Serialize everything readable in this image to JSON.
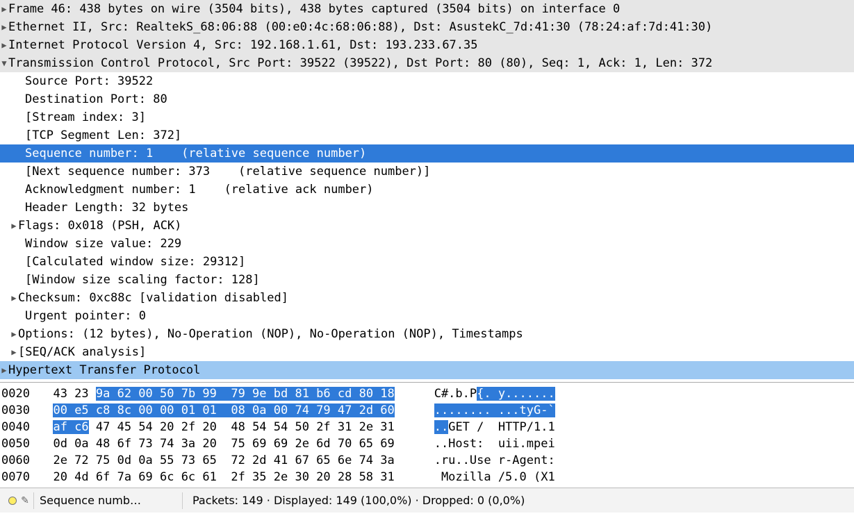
{
  "tree": {
    "frame": "Frame 46: 438 bytes on wire (3504 bits), 438 bytes captured (3504 bits) on interface 0",
    "eth": "Ethernet II, Src: RealtekS_68:06:88 (00:e0:4c:68:06:88), Dst: AsustekC_7d:41:30 (78:24:af:7d:41:30)",
    "ip": "Internet Protocol Version 4, Src: 192.168.1.61, Dst: 193.233.67.35",
    "tcp": "Transmission Control Protocol, Src Port: 39522 (39522), Dst Port: 80 (80), Seq: 1, Ack: 1, Len: 372",
    "srcport": "Source Port: 39522",
    "dstport": "Destination Port: 80",
    "stream": "[Stream index: 3]",
    "seglen": "[TCP Segment Len: 372]",
    "seqnum": "Sequence number: 1    (relative sequence number)",
    "nextseq": "[Next sequence number: 373    (relative sequence number)]",
    "acknum": "Acknowledgment number: 1    (relative ack number)",
    "hdrlen": "Header Length: 32 bytes",
    "flags": "Flags: 0x018 (PSH, ACK)",
    "winsize": "Window size value: 229",
    "calcwin": "[Calculated window size: 29312]",
    "winscale": "[Window size scaling factor: 128]",
    "checksum": "Checksum: 0xc88c [validation disabled]",
    "urgent": "Urgent pointer: 0",
    "options": "Options: (12 bytes), No-Operation (NOP), No-Operation (NOP), Timestamps",
    "seqack": "[SEQ/ACK analysis]",
    "http": "Hypertext Transfer Protocol"
  },
  "hex": {
    "rows": [
      {
        "off": "0020",
        "pre": "  43 23 ",
        "hl": "9a 62 00 50 7b 99  79 9e bd 81 b6 cd 80 18",
        "post": "",
        "asc_pre": "   C#.b.P",
        "asc_hl": "{. y.......",
        "asc_post": ""
      },
      {
        "off": "0030",
        "pre": "  ",
        "hl": "00 e5 c8 8c 00 00 01 01  08 0a 00 74 79 47 2d 60",
        "post": "",
        "asc_pre": "   ",
        "asc_hl": "........ ...tyG-`",
        "asc_post": ""
      },
      {
        "off": "0040",
        "pre": "  ",
        "hl": "af c6",
        "post": " 47 45 54 20 2f 20  48 54 54 50 2f 31 2e 31",
        "asc_pre": "   ",
        "asc_hl": "..",
        "asc_post": "GET /  HTTP/1.1"
      },
      {
        "off": "0050",
        "pre": "  0d 0a 48 6f 73 74 3a 20  75 69 69 2e 6d 70 65 69",
        "hl": "",
        "post": "",
        "asc_pre": "   ..Host:  uii.mpei",
        "asc_hl": "",
        "asc_post": ""
      },
      {
        "off": "0060",
        "pre": "  2e 72 75 0d 0a 55 73 65  72 2d 41 67 65 6e 74 3a",
        "hl": "",
        "post": "",
        "asc_pre": "   .ru..Use r-Agent:",
        "asc_hl": "",
        "asc_post": ""
      },
      {
        "off": "0070",
        "pre": "  20 4d 6f 7a 69 6c 6c 61  2f 35 2e 30 20 28 58 31",
        "hl": "",
        "post": "",
        "asc_pre": "    Mozilla /5.0 (X1",
        "asc_hl": "",
        "asc_post": ""
      }
    ]
  },
  "status": {
    "field": "Sequence numb…",
    "packets": "Packets: 149 · Displayed: 149 (100,0%)  · Dropped: 0 (0,0%)"
  }
}
